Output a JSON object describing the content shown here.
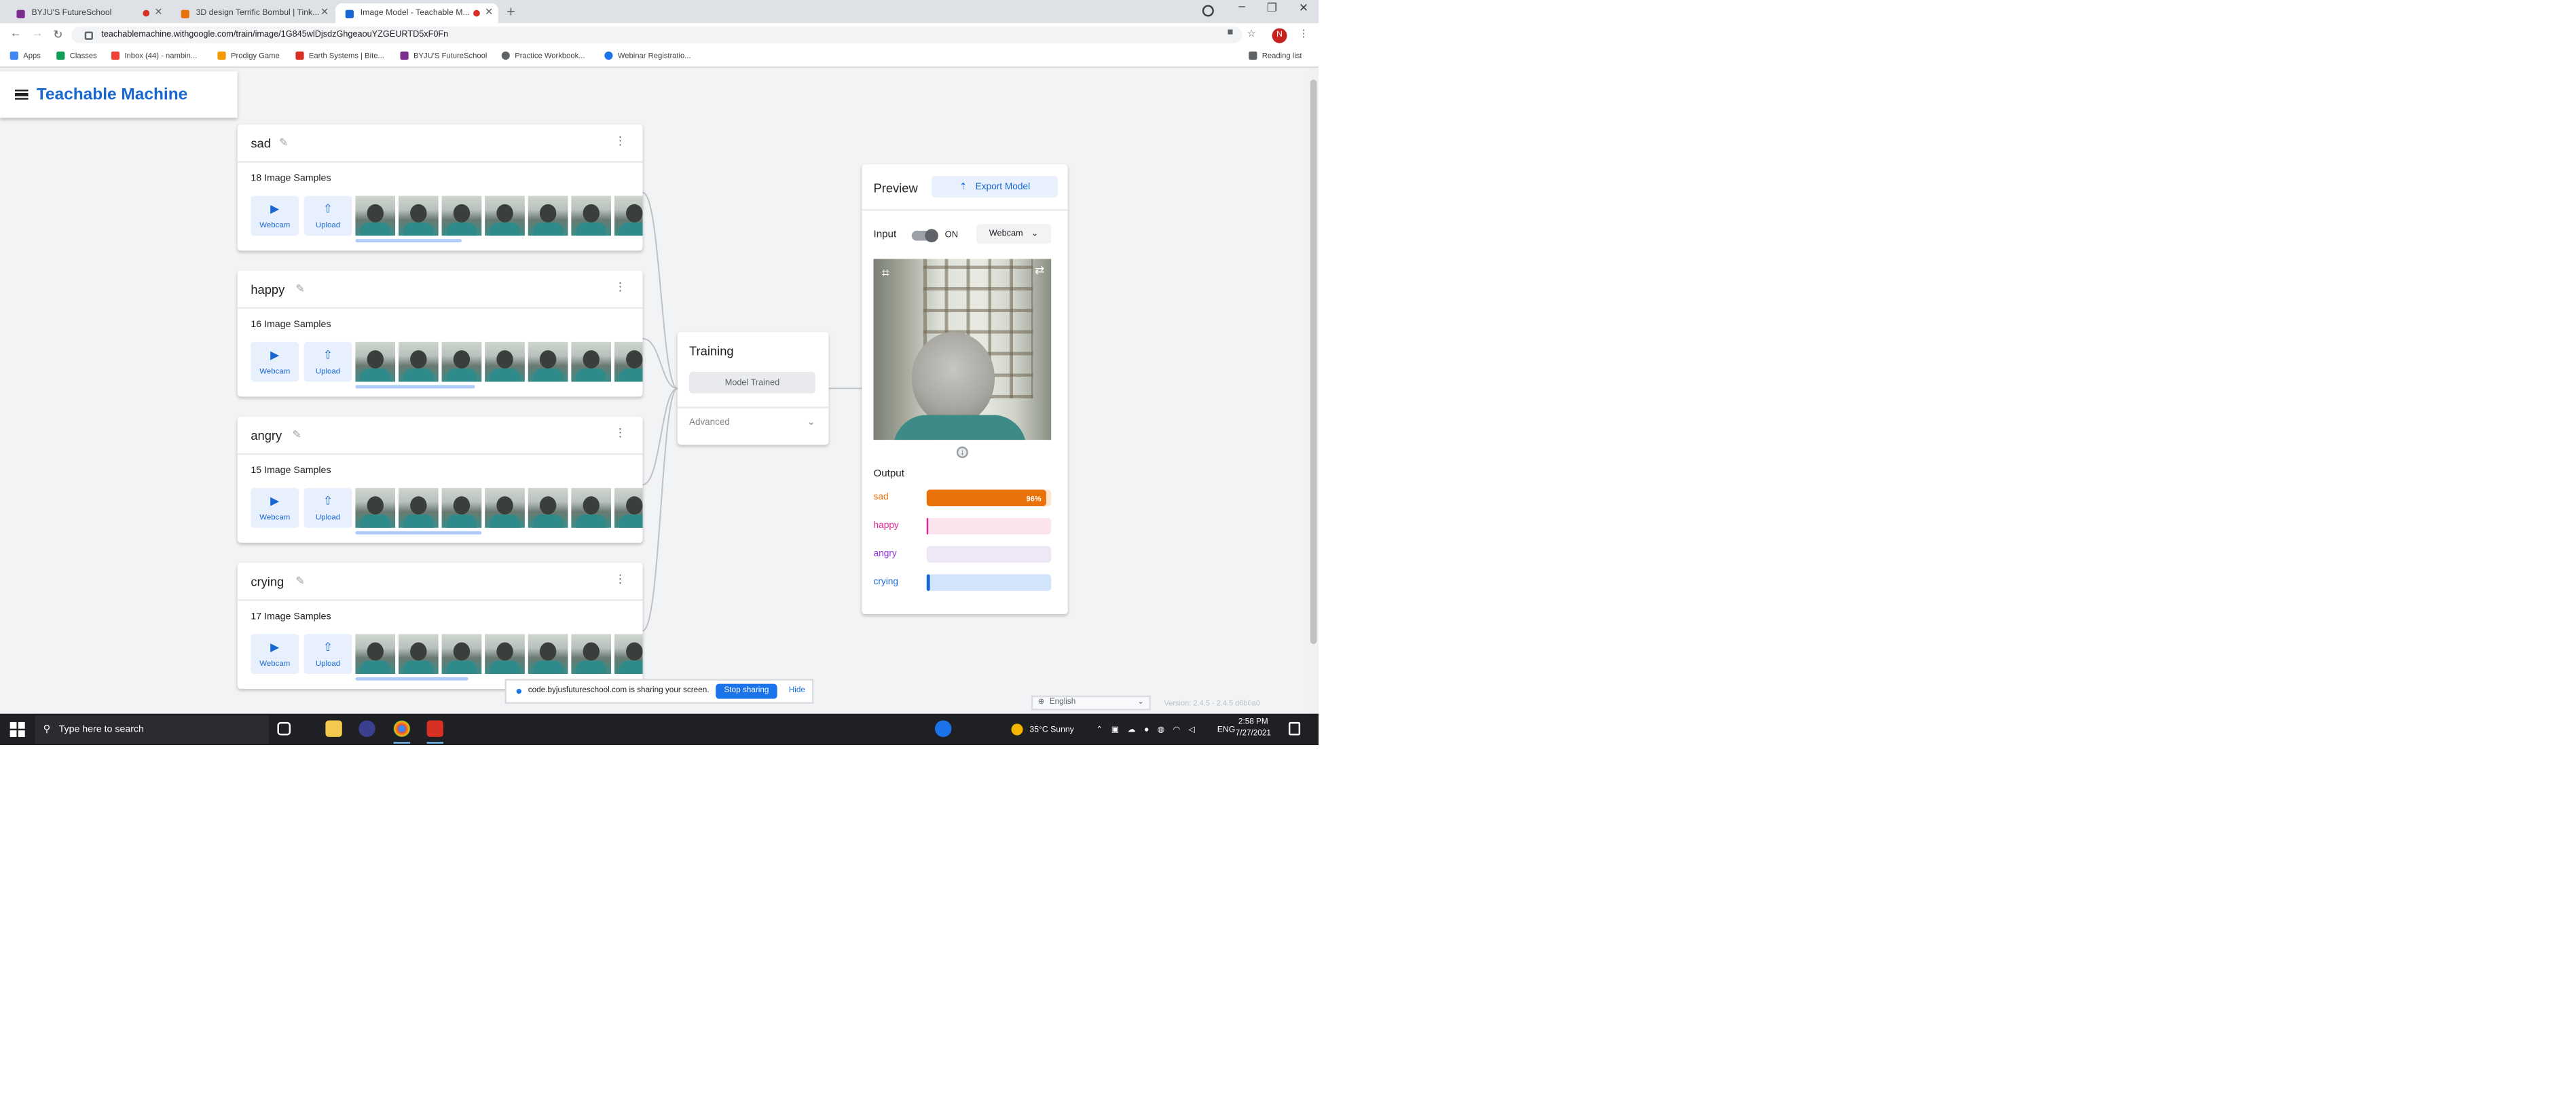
{
  "browser": {
    "tabs": [
      {
        "title": "BYJU'S FutureSchool",
        "favicon_color": "#7b2d8e",
        "recording": true
      },
      {
        "title": "3D design Terrific Bombul | Tink...",
        "favicon_color": "#e8710a",
        "recording": false
      },
      {
        "title": "Image Model - Teachable M...",
        "favicon_color": "#1967d2",
        "recording": true
      }
    ],
    "url": "teachablemachine.withgoogle.com/train/image/1G845wlDjsdzGhgeaouYZGEURTD5xF0Fn",
    "bookmarks": [
      "Apps",
      "Classes",
      "Inbox (44) - nambin...",
      "Prodigy Game",
      "Earth Systems | Bite...",
      "BYJU'S FutureSchool",
      "Practice Workbook...",
      "Webinar Registratio..."
    ],
    "reading_list": "Reading list",
    "profile_initial": "N"
  },
  "app": {
    "brand": "Teachable Machine",
    "classes": [
      {
        "name": "sad",
        "samples": "18 Image Samples"
      },
      {
        "name": "happy",
        "samples": "16 Image Samples"
      },
      {
        "name": "angry",
        "samples": "15 Image Samples"
      },
      {
        "name": "crying",
        "samples": "17 Image Samples"
      }
    ],
    "webcam_label": "Webcam",
    "upload_label": "Upload",
    "training": {
      "title": "Training",
      "button": "Model Trained",
      "advanced": "Advanced"
    },
    "preview": {
      "title": "Preview",
      "export": "Export Model",
      "input_label": "Input",
      "toggle_state": "ON",
      "source": "Webcam",
      "output_label": "Output",
      "outputs": [
        {
          "label": "sad",
          "percent": 96,
          "percent_text": "96%",
          "color": "#e8710a",
          "track": "#fde5cf"
        },
        {
          "label": "happy",
          "percent": 1,
          "percent_text": "",
          "color": "#e52592",
          "track": "#fce4ec"
        },
        {
          "label": "angry",
          "percent": 0,
          "percent_text": "",
          "color": "#9334e6",
          "track": "#ede7f6"
        },
        {
          "label": "crying",
          "percent": 3,
          "percent_text": "",
          "color": "#1967d2",
          "track": "#d2e3fc"
        }
      ]
    },
    "share_bar": {
      "message": "code.byjusfutureschool.com is sharing your screen.",
      "stop": "Stop sharing",
      "hide": "Hide"
    },
    "language": "English",
    "version": "Version: 2.4.5 - 2.4.5 d6b0a0"
  },
  "taskbar": {
    "search_placeholder": "Type here to search",
    "weather": "35°C  Sunny",
    "lang": "ENG",
    "time": "2:58 PM",
    "date": "7/27/2021"
  }
}
